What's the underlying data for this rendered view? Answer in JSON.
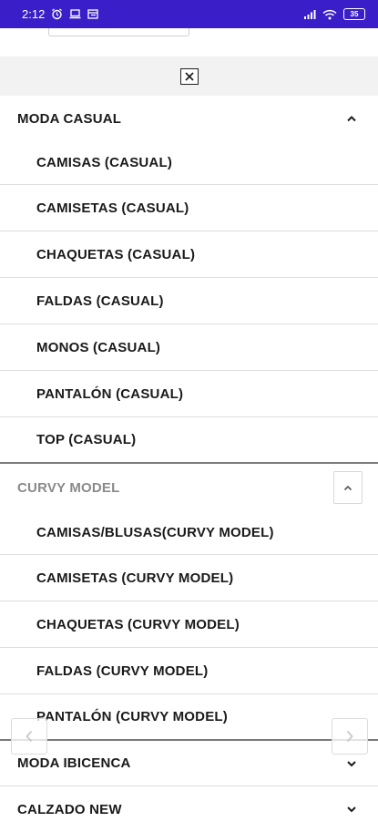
{
  "status_bar": {
    "time": "2:12",
    "battery": "35"
  },
  "close_button_label": "×",
  "sections": [
    {
      "title": "MODA CASUAL",
      "expanded": true,
      "items": [
        "CAMISAS (CASUAL)",
        "CAMISETAS (CASUAL)",
        "CHAQUETAS (CASUAL)",
        "FALDAS (CASUAL)",
        "MONOS (CASUAL)",
        "PANTALÓN (CASUAL)",
        "TOP (CASUAL)"
      ]
    },
    {
      "title": "CURVY MODEL",
      "expanded": true,
      "items": [
        "CAMISAS/BLUSAS(CURVY MODEL)",
        "CAMISETAS (CURVY MODEL)",
        "CHAQUETAS (CURVY MODEL)",
        "FALDAS (CURVY MODEL)",
        "PANTALÓN (CURVY MODEL)"
      ]
    },
    {
      "title": "MODA IBICENCA",
      "expanded": false
    },
    {
      "title": "CALZADO NEW",
      "expanded": false
    }
  ],
  "colors": {
    "status_bar": "#3a1fc9",
    "muted_header": "#8a8a8a"
  }
}
